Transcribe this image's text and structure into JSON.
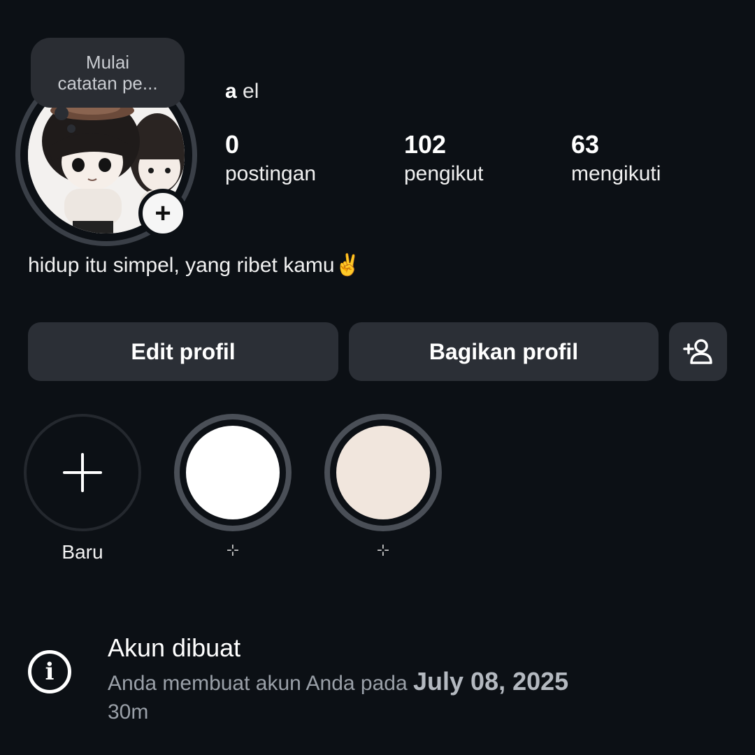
{
  "note": {
    "line1": "Mulai",
    "line2": "catatan pe..."
  },
  "profile": {
    "username_bold": "a",
    "username_rest": "el",
    "bio": "hidup itu simpel, yang ribet kamu✌️",
    "avatar_add_symbol": "+"
  },
  "stats": [
    {
      "value": "0",
      "label": "postingan"
    },
    {
      "value": "102",
      "label": "pengikut"
    },
    {
      "value": "63",
      "label": "mengikuti"
    }
  ],
  "buttons": {
    "edit": "Edit profil",
    "share": "Bagikan profil",
    "add_person_icon": "person-add-icon"
  },
  "highlights": [
    {
      "label": "Baru",
      "icon": "plus-icon"
    },
    {
      "label": "⊹",
      "fill": "#ffffff"
    },
    {
      "label": "⊹",
      "fill": "#f1e6dd"
    }
  ],
  "account_info": {
    "icon": "info-icon",
    "title": "Akun dibuat",
    "desc_prefix": "Anda membuat akun Anda pada",
    "date": "July 08, 2025",
    "time_ago": "30m"
  },
  "colors": {
    "background": "#0c1015",
    "button_bg": "#2b2f36",
    "ring": "#4a4f57"
  }
}
